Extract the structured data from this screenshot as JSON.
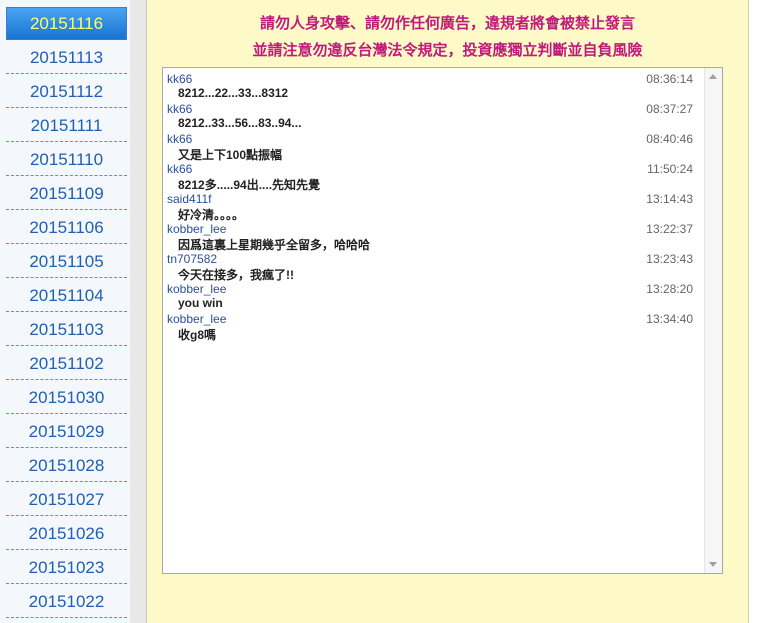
{
  "sidebar": {
    "dates": [
      "20151116",
      "20151113",
      "20151112",
      "20151111",
      "20151110",
      "20151109",
      "20151106",
      "20151105",
      "20151104",
      "20151103",
      "20151102",
      "20151030",
      "20151029",
      "20151028",
      "20151027",
      "20151026",
      "20151023",
      "20151022"
    ],
    "selected": "20151116"
  },
  "notices": {
    "line1": "請勿人身攻擊、請勿作任何廣告，違規者將會被禁止發言",
    "line2": "並請注意勿違反台灣法令規定，投資應獨立判斷並自負風險"
  },
  "chat": {
    "messages": [
      {
        "user": "kk66",
        "time": "08:36:14",
        "text": "8212...22...33...8312"
      },
      {
        "user": "kk66",
        "time": "08:37:27",
        "text": "8212..33...56...83..94..."
      },
      {
        "user": "kk66",
        "time": "08:40:46",
        "text": "又是上下100點振幅"
      },
      {
        "user": "kk66",
        "time": "11:50:24",
        "text": "8212多.....94出....先知先覺"
      },
      {
        "user": "said411f",
        "time": "13:14:43",
        "text": "好冷清。。。。"
      },
      {
        "user": "kobber_lee",
        "time": "13:22:37",
        "text": "因爲這裏上星期幾乎全留多，哈哈哈"
      },
      {
        "user": "tn707582",
        "time": "13:23:43",
        "text": "今天在接多，我瘋了!!"
      },
      {
        "user": "kobber_lee",
        "time": "13:28:20",
        "text": "you win"
      },
      {
        "user": "kobber_lee",
        "time": "13:34:40",
        "text": "收g8嗎"
      }
    ]
  },
  "colors": {
    "main_bg": "#fefac8",
    "notice": "#c01a7a",
    "date_link": "#1f5fb5",
    "selected_bg": "#1874d2",
    "selected_text": "#ffff66"
  }
}
